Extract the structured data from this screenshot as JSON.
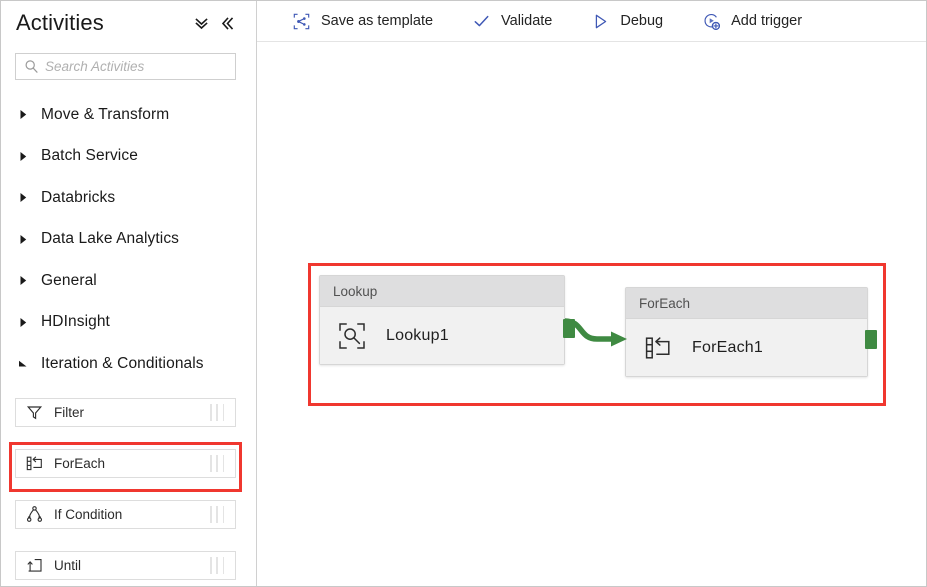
{
  "sidebar": {
    "title": "Activities",
    "header_buttons": [
      {
        "name": "collapse-all-icon",
        "label": "Collapse all"
      },
      {
        "name": "collapse-panel-icon",
        "label": "Collapse panel"
      }
    ],
    "search": {
      "placeholder": "Search Activities",
      "value": "",
      "icon": "search-icon"
    },
    "categories": [
      {
        "label": "Move & Transform",
        "expanded": false
      },
      {
        "label": "Batch Service",
        "expanded": false
      },
      {
        "label": "Databricks",
        "expanded": false
      },
      {
        "label": "Data Lake Analytics",
        "expanded": false
      },
      {
        "label": "General",
        "expanded": false
      },
      {
        "label": "HDInsight",
        "expanded": false
      },
      {
        "label": "Iteration & Conditionals",
        "expanded": true
      }
    ],
    "activities": [
      {
        "label": "Filter",
        "icon": "filter-icon",
        "highlighted": false
      },
      {
        "label": "ForEach",
        "icon": "foreach-icon",
        "highlighted": true
      },
      {
        "label": "If Condition",
        "icon": "if-condition-icon",
        "highlighted": false
      },
      {
        "label": "Until",
        "icon": "until-icon",
        "highlighted": false
      }
    ]
  },
  "toolbar": {
    "buttons": [
      {
        "label": "Save as template",
        "icon": "save-as-template-icon"
      },
      {
        "label": "Validate",
        "icon": "checkmark-icon"
      },
      {
        "label": "Debug",
        "icon": "play-triangle-icon"
      },
      {
        "label": "Add trigger",
        "icon": "add-trigger-icon"
      }
    ]
  },
  "canvas": {
    "nodes": [
      {
        "type_label": "Lookup",
        "name": "Lookup1",
        "icon": "lookup-magnifier-icon",
        "output_port_color": "#3f8a42"
      },
      {
        "type_label": "ForEach",
        "name": "ForEach1",
        "icon": "foreach-icon",
        "output_port_color": "#3f8a42"
      }
    ],
    "connector": {
      "from": "Lookup1",
      "to": "ForEach1",
      "color": "#3f8a42",
      "style": "success-dependency"
    },
    "highlight_color": "#f0372f"
  },
  "colors": {
    "accent": "#3f58b5",
    "highlight": "#f0372f",
    "node_header": "#dededf",
    "node_body": "#f1f1f1",
    "connector_green": "#3f8a42"
  }
}
